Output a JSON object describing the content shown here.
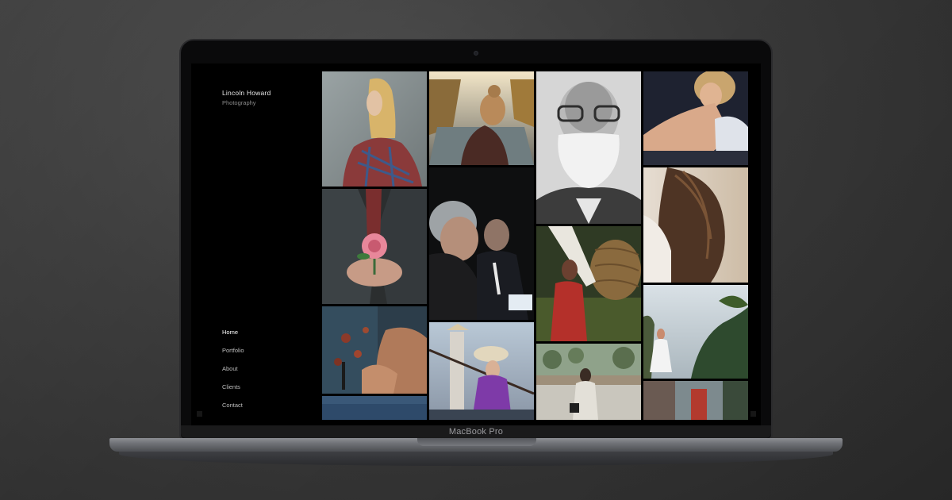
{
  "site": {
    "brand_name": "Lincoln Howard",
    "brand_tagline": "Photography",
    "nav": [
      {
        "label": "Home",
        "active": true
      },
      {
        "label": "Portfolio",
        "active": false
      },
      {
        "label": "About",
        "active": false
      },
      {
        "label": "Clients",
        "active": false
      },
      {
        "label": "Contact",
        "active": false
      }
    ]
  },
  "device": {
    "label": "MacBook Pro"
  },
  "gallery": {
    "photos": [
      {
        "name": "woman-plaid-shirt-profile"
      },
      {
        "name": "woman-hair-bun-canal"
      },
      {
        "name": "elderly-man-white-beard"
      },
      {
        "name": "woman-sitting-sunlight"
      },
      {
        "name": "hands-holding-pink-flower"
      },
      {
        "name": "elderly-couple-dark"
      },
      {
        "name": "woman-long-hair-back"
      },
      {
        "name": "woman-carrying-basket"
      },
      {
        "name": "hands-crafting-workshop"
      },
      {
        "name": "boatmen-conical-hats"
      },
      {
        "name": "woman-white-dress-trees"
      },
      {
        "name": "woman-walking-park"
      },
      {
        "name": "partial-blue-tile"
      },
      {
        "name": "partial-red-tile"
      }
    ]
  },
  "colors": {
    "screen_bg": "#000000",
    "nav_active": "#ffffff",
    "nav_inactive": "#bdbdbd",
    "background": "#3a3a3a"
  }
}
